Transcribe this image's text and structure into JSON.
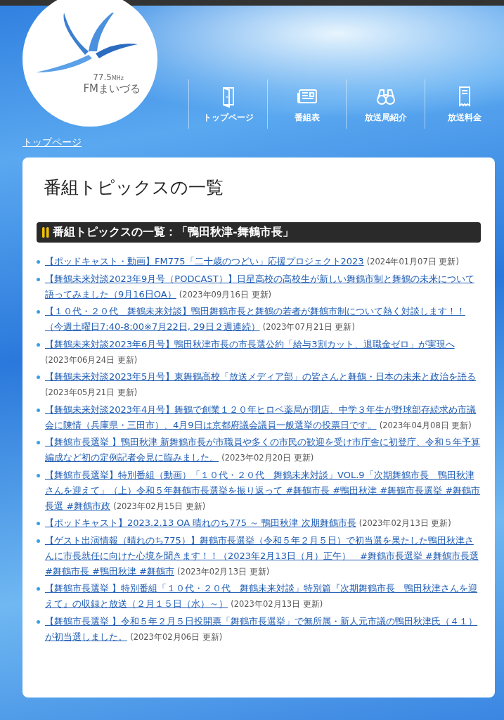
{
  "logo": {
    "frequency": "77.5",
    "unit": "MHz",
    "name": "FMまいづる"
  },
  "nav": [
    {
      "label": "トップページ"
    },
    {
      "label": "番組表"
    },
    {
      "label": "放送局紹介"
    },
    {
      "label": "放送料金"
    }
  ],
  "breadcrumb": "トップページ",
  "page_title": "番組トピックスの一覧",
  "section_title": "番組トピックスの一覧：「鴨田秋津-舞鶴市長」",
  "topics": [
    {
      "title": "【ポッドキャスト・動画】FM775「二十歳のつどい」応援プロジェクト2023",
      "date": "(2024年01月07日 更新)"
    },
    {
      "title": "【舞鶴未来対談2023年9月号（PODCAST）】日星高校の高校生が新しい舞鶴市制と舞鶴の未来について語ってみました（9月16日OA）",
      "date": "(2023年09月16日 更新)"
    },
    {
      "title": "【１０代・２０代　舞鶴未来対談】鴨田舞鶴市長と舞鶴の若者が舞鶴市制について熱く対談します！！（今週土曜日7:40-8:00※7月22日, 29日２週連続）",
      "date": "(2023年07月21日 更新)"
    },
    {
      "title": "【舞鶴未来対談2023年6月号】鴨田秋津市長の市長選公約「給与3割カット、退職金ゼロ」が実現へ",
      "date": "(2023年06月24日 更新)"
    },
    {
      "title": "【舞鶴未来対談2023年5月号】東舞鶴高校「放送メディア部」の皆さんと舞鶴・日本の未来と政治を語る",
      "date": "(2023年05月21日 更新)"
    },
    {
      "title": "【舞鶴未来対談2023年4月号】舞鶴で創業１２０年ヒロベ薬局が閉店、中学３年生が野球部存続求め市議会に陳情（兵庫県・三田市）、4月9日は京都府議会議員一般選挙の投票日です。",
      "date": "(2023年04月08日 更新)"
    },
    {
      "title": "【舞鶴市長選挙 】鴨田秋津 新舞鶴市長が市職員や多くの市民の歓迎を受け市庁舎に初登庁、令和５年予算編成など初の定例記者会見に臨みました。",
      "date": "(2023年02月20日 更新)"
    },
    {
      "title": "【舞鶴市長選挙】特別番組（動画）「１０代・２０代　舞鶴未来対談」VOL.9「次期舞鶴市長　鴨田秋津さんを迎えて」（上）令和５年舞鶴市長選挙を振り返って #舞鶴市長 #鴨田秋津 #舞鶴市長選挙 #舞鶴市長選 #舞鶴市政",
      "date": "(2023年02月15日 更新)"
    },
    {
      "title": "【ポッドキャスト】2023.2.13 OA 晴れのち775 ～ 鴨田秋津 次期舞鶴市長",
      "date": "(2023年02月13日 更新)"
    },
    {
      "title": "【ゲスト出演情報（晴れのち775）】舞鶴市長選挙（令和５年２月５日）で初当選を果たした鴨田秋津さんに市長就任に向けた心境を聞きます！！（2023年2月13日（月）正午）　#舞鶴市長選挙 #舞鶴市長選 #舞鶴市長 #鴨田秋津 #舞鶴市",
      "date": "(2023年02月13日 更新)"
    },
    {
      "title": "【舞鶴市長選挙 】特別番組「１０代・２０代　舞鶴未来対談」特別篇『次期舞鶴市長　鴨田秋津さんを迎えて』の収録と放送（２月１５日（水）～）",
      "date": "(2023年02月13日 更新)"
    },
    {
      "title": "【舞鶴市長選挙 】令和５年２月５日投開票「舞鶴市長選挙」で無所属・新人元市議の鴨田秋津氏（４１）が初当選しました。",
      "date": "(2023年02月06日 更新)"
    }
  ]
}
